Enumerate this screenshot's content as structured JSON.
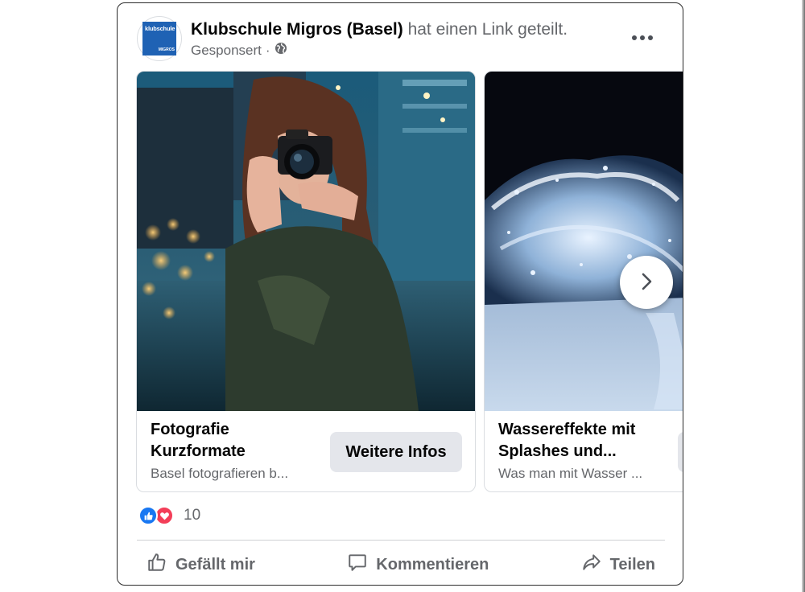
{
  "post": {
    "page_name": "Klubschule Migros (Basel)",
    "shared_text": "hat einen Link geteilt.",
    "sponsored_label": "Gesponsert",
    "separator": "·",
    "audience_icon": "globe-icon",
    "more_icon": "more-options-icon",
    "avatar": {
      "logo_top": "klubschule",
      "logo_bottom": "MIGROS",
      "logo_color": "#1f62b4"
    }
  },
  "carousel": {
    "cards": [
      {
        "title": "Fotografie Kurzformate",
        "description": "Basel fotografieren b...",
        "cta": "Weitere Infos",
        "image": "photographer-with-camera-photo"
      },
      {
        "title": "Wassereffekte mit Splashes und...",
        "description": "Was man mit Wasser ...",
        "image": "water-splash-photo"
      }
    ],
    "next_icon": "chevron-right-icon"
  },
  "reactions": {
    "icons": [
      "like-reaction-icon",
      "love-reaction-icon"
    ],
    "count": "10",
    "like_color": "#1877f2",
    "love_color": "#f33e58"
  },
  "actions": {
    "like": "Gefällt mir",
    "comment": "Kommentieren",
    "share": "Teilen"
  },
  "colors": {
    "text_primary": "#050505",
    "text_secondary": "#65676b",
    "button_bg": "#e4e6eb"
  }
}
